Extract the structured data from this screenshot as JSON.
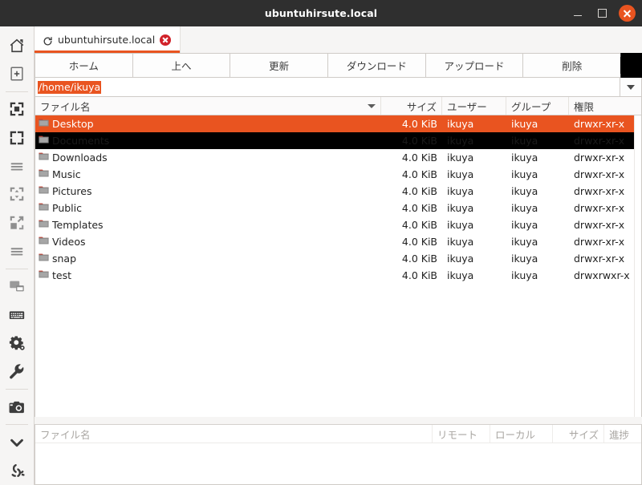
{
  "window": {
    "title": "ubuntuhirsute.local",
    "buttons": {
      "minimize": "minimize-button",
      "maximize": "maximize-button",
      "close": "close-button"
    }
  },
  "sidebar": {
    "items": [
      {
        "name": "home-icon",
        "label": "Home"
      },
      {
        "name": "new-tab-icon",
        "label": "New Tab"
      },
      {
        "name": "select-area-icon",
        "label": "Select Area"
      },
      {
        "name": "fullscreen-icon",
        "label": "Fullscreen"
      },
      {
        "name": "list-lines-icon",
        "label": "List"
      },
      {
        "name": "fit-screen-icon",
        "label": "Fit Screen"
      },
      {
        "name": "scale-icon",
        "label": "Scale"
      },
      {
        "name": "list-lines-2-icon",
        "label": "List 2"
      },
      {
        "name": "window-icon",
        "label": "Window"
      },
      {
        "name": "keyboard-icon",
        "label": "Keyboard"
      },
      {
        "name": "settings-gear-icon",
        "label": "Settings"
      },
      {
        "name": "wrench-icon",
        "label": "Tools"
      },
      {
        "name": "camera-icon",
        "label": "Screenshot"
      },
      {
        "name": "chevron-down-icon",
        "label": "More"
      },
      {
        "name": "broken-link-icon",
        "label": "Disconnect"
      }
    ]
  },
  "tab": {
    "label": "ubuntuhirsute.local",
    "reload_icon": "reload-icon",
    "close_icon": "close-icon"
  },
  "toolbar": {
    "buttons": [
      {
        "label": "ホーム",
        "name": "toolbar-home"
      },
      {
        "label": "上へ",
        "name": "toolbar-up"
      },
      {
        "label": "更新",
        "name": "toolbar-refresh"
      },
      {
        "label": "ダウンロード",
        "name": "toolbar-download"
      },
      {
        "label": "アップロード",
        "name": "toolbar-upload"
      },
      {
        "label": "削除",
        "name": "toolbar-delete"
      }
    ]
  },
  "pathbar": {
    "value": "/home/ikuya",
    "dropdown_icon": "chevron-down-icon"
  },
  "filelist": {
    "columns": [
      {
        "key": "name",
        "label": "ファイル名"
      },
      {
        "key": "size",
        "label": "サイズ"
      },
      {
        "key": "user",
        "label": "ユーザー"
      },
      {
        "key": "group",
        "label": "グループ"
      },
      {
        "key": "perm",
        "label": "権限"
      }
    ],
    "rows": [
      {
        "name": "Desktop",
        "size": "4.0 KiB",
        "user": "ikuya",
        "group": "ikuya",
        "perm": "drwxr-xr-x",
        "state": "selected"
      },
      {
        "name": "Documents",
        "size": "4.0 KiB",
        "user": "ikuya",
        "group": "ikuya",
        "perm": "drwxr-xr-x",
        "state": "cursor"
      },
      {
        "name": "Downloads",
        "size": "4.0 KiB",
        "user": "ikuya",
        "group": "ikuya",
        "perm": "drwxr-xr-x",
        "state": ""
      },
      {
        "name": "Music",
        "size": "4.0 KiB",
        "user": "ikuya",
        "group": "ikuya",
        "perm": "drwxr-xr-x",
        "state": ""
      },
      {
        "name": "Pictures",
        "size": "4.0 KiB",
        "user": "ikuya",
        "group": "ikuya",
        "perm": "drwxr-xr-x",
        "state": ""
      },
      {
        "name": "Public",
        "size": "4.0 KiB",
        "user": "ikuya",
        "group": "ikuya",
        "perm": "drwxr-xr-x",
        "state": ""
      },
      {
        "name": "Templates",
        "size": "4.0 KiB",
        "user": "ikuya",
        "group": "ikuya",
        "perm": "drwxr-xr-x",
        "state": ""
      },
      {
        "name": "Videos",
        "size": "4.0 KiB",
        "user": "ikuya",
        "group": "ikuya",
        "perm": "drwxr-xr-x",
        "state": ""
      },
      {
        "name": "snap",
        "size": "4.0 KiB",
        "user": "ikuya",
        "group": "ikuya",
        "perm": "drwxr-xr-x",
        "state": ""
      },
      {
        "name": "test",
        "size": "4.0 KiB",
        "user": "ikuya",
        "group": "ikuya",
        "perm": "drwxrwxr-x",
        "state": ""
      }
    ]
  },
  "queue": {
    "columns": [
      {
        "key": "name",
        "label": "ファイル名"
      },
      {
        "key": "remote",
        "label": "リモート"
      },
      {
        "key": "local",
        "label": "ローカル"
      },
      {
        "key": "size",
        "label": "サイズ"
      },
      {
        "key": "prog",
        "label": "進捗"
      }
    ],
    "rows": []
  },
  "colors": {
    "accent": "#e95420",
    "titlebar": "#2f2f2f",
    "tab_close": "#d1222a",
    "chrome": "#f6f5f4"
  }
}
